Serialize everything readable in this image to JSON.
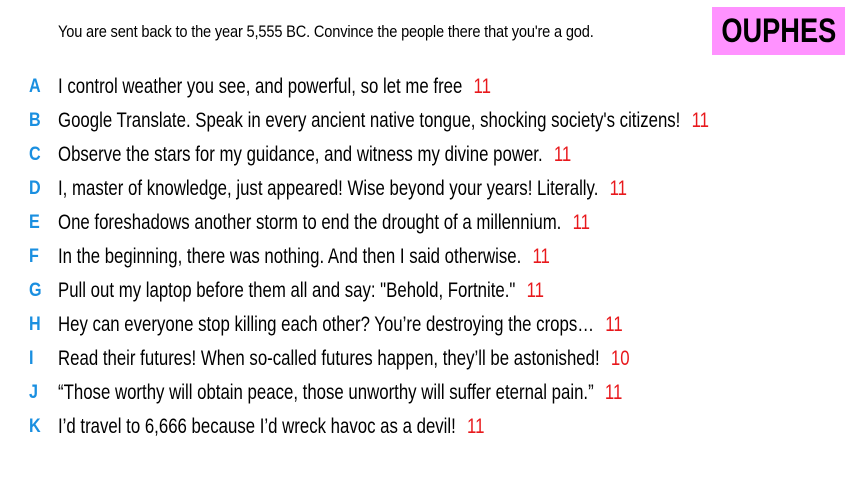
{
  "prompt": "You are sent back to the year 5,555 BC. Convince the people there that you're a god.",
  "badge": "OUPHES",
  "colors": {
    "letter": "#1a8fe0",
    "score": "#e8181c",
    "badge_bg": "#ff92ff"
  },
  "answers": [
    {
      "letter": "A",
      "text": "I control weather you see, and powerful, so let me free",
      "score": "11"
    },
    {
      "letter": "B",
      "text": "Google Translate. Speak in every ancient native tongue, shocking society's citizens!",
      "score": "11"
    },
    {
      "letter": "C",
      "text": "Observe the stars for my guidance, and witness my divine power.",
      "score": "11"
    },
    {
      "letter": "D",
      "text": "I, master of knowledge, just appeared! Wise beyond your years! Literally.",
      "score": "11"
    },
    {
      "letter": "E",
      "text": "One foreshadows another storm to end the drought of a millennium.",
      "score": "11"
    },
    {
      "letter": "F",
      "text": "In the beginning, there was nothing. And then I said otherwise.",
      "score": "11"
    },
    {
      "letter": "G",
      "text": "Pull out my laptop before them all and say: \"Behold, Fortnite.\"",
      "score": "11"
    },
    {
      "letter": "H",
      "text": "Hey can everyone stop killing each other? You’re destroying the crops…",
      "score": "11"
    },
    {
      "letter": "I",
      "text": "Read their futures! When so-called futures happen, they’ll be astonished!",
      "score": "10"
    },
    {
      "letter": "J",
      "text": "“Those worthy will obtain peace, those unworthy will suffer eternal pain.”",
      "score": "11"
    },
    {
      "letter": "K",
      "text": "I’d travel to 6,666 because I’d wreck havoc as a devil!",
      "score": "11"
    }
  ]
}
